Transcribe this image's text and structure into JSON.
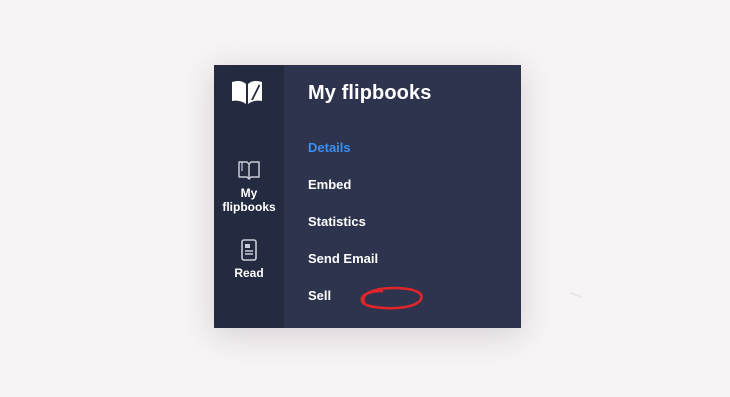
{
  "rail": {
    "items": [
      {
        "label_line1": "My",
        "label_line2": "flipbooks",
        "icon": "open-book-icon"
      },
      {
        "label": "Read",
        "icon": "document-icon"
      }
    ]
  },
  "panel": {
    "title": "My flipbooks",
    "menu": [
      {
        "label": "Details",
        "active": true
      },
      {
        "label": "Embed",
        "active": false
      },
      {
        "label": "Statistics",
        "active": false
      },
      {
        "label": "Send Email",
        "active": false
      },
      {
        "label": "Sell",
        "active": false
      }
    ]
  },
  "colors": {
    "rail_bg": "#242a3f",
    "panel_bg": "#2e344d",
    "active": "#3b8ef0",
    "annotation": "#e0262b"
  }
}
